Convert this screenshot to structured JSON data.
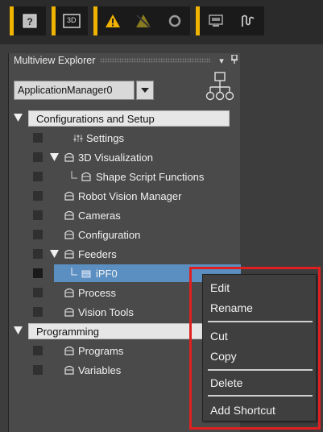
{
  "toolbar": {
    "icons": [
      "help-icon",
      "3d-view-icon",
      "warning-icon",
      "clear-warning-icon",
      "refresh-icon",
      "monitor-icon",
      "signal-icon"
    ],
    "accent": "#f0b400",
    "threed_label": "3D"
  },
  "panel": {
    "title": "Multiview Explorer",
    "pin_glyph": "▾",
    "close_glyph": "ꟸ"
  },
  "app_select": {
    "value": "ApplicationManager0"
  },
  "tree": {
    "configurations_section": "Configurations and Setup",
    "settings": "Settings",
    "visualization_3d": "3D Visualization",
    "shape_script": "Shape Script Functions",
    "robot_vision": "Robot Vision Manager",
    "cameras": "Cameras",
    "configuration": "Configuration",
    "feeders": "Feeders",
    "ipf0": "iPF0",
    "process": "Process",
    "vision_tools": "Vision Tools",
    "programming_section": "Programming",
    "programs": "Programs",
    "variables": "Variables"
  },
  "context_menu": {
    "edit": "Edit",
    "rename": "Rename",
    "cut": "Cut",
    "copy": "Copy",
    "delete": "Delete",
    "add_shortcut": "Add Shortcut"
  },
  "colors": {
    "selection": "#5b8fc2",
    "highlight": "#e02020"
  }
}
